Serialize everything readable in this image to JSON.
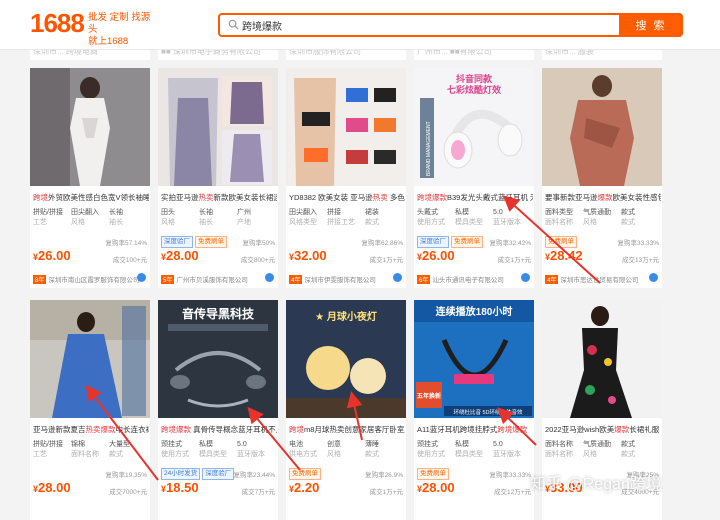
{
  "header": {
    "logo": "1688",
    "slogan_line1": "批发 定制 找源头",
    "slogan_line2": "就上1688",
    "search_value": "跨境爆款",
    "search_button": "搜 索"
  },
  "top_strip": [
    "深圳市... 跨境电商",
    "■■ 深圳市电子商务有限公司",
    "深圳市服饰有限公司",
    "广州市... ■■有限公司",
    "深圳市... 服装"
  ],
  "products": [
    {
      "title_pre": "",
      "title_hl": "跨境",
      "title_post": "外贸欧美性感白色宽V领长袖睡裙",
      "attrs": [
        [
          "拼贴/拼接",
          "工艺"
        ],
        [
          "田尖翻入",
          "风格"
        ],
        [
          "长袖",
          "袖长"
        ]
      ],
      "tags": [],
      "repurchase": "复购率57.14%",
      "price": "26.00",
      "sold": "成交100+元",
      "year": "8年",
      "shop": "深圳市南山区霞罗服饰有限公司"
    },
    {
      "title_pre": "实拍亚马逊",
      "title_hl": "热卖",
      "title_post": "新款欧美女装长裙连衣裙",
      "attrs": [
        [
          "田头",
          "风格"
        ],
        [
          "长袖",
          "袖长"
        ],
        [
          "广州",
          "产地"
        ]
      ],
      "tags": [
        [
          "深度验厂",
          "b"
        ],
        [
          "免费刷单",
          "o"
        ]
      ],
      "repurchase": "复购率50%",
      "price": "28.00",
      "sold": "成交800+元",
      "year": "5年",
      "shop": "广州市贝溪服饰有限公司"
    },
    {
      "title_pre": "YD8382 欧美女装 亚马逊",
      "title_hl": "热卖",
      "title_post": " 多色套装",
      "attrs": [
        [
          "田尖翻入",
          "风格类型"
        ],
        [
          "拼接",
          "拼接工艺"
        ],
        [
          "裙装",
          "款式"
        ]
      ],
      "tags": [],
      "repurchase": "复购率62.86%",
      "price": "32.00",
      "sold": "成交1万+元",
      "year": "4年",
      "shop": "深圳市伊雯服饰有限公司"
    },
    {
      "title_pre": "",
      "title_hl": "跨境爆款",
      "title_post": "B39发光头戴式蓝牙耳机 无",
      "attrs": [
        [
          "头戴式",
          "使用方式"
        ],
        [
          "私模",
          "模具类型"
        ],
        [
          "5.0",
          "蓝牙版本"
        ]
      ],
      "tags": [
        [
          "深度验厂",
          "b"
        ],
        [
          "免费刷单",
          "o"
        ]
      ],
      "repurchase": "复购率32.42%",
      "price": "26.00",
      "sold": "成交1万+元",
      "year": "6年",
      "shop": "汕头市通讯电子有限公司"
    },
    {
      "title_pre": "要事新款亚马逊",
      "title_hl": "爆款",
      "title_post": "欧美女装性感包",
      "attrs": [
        [
          "面料类型",
          "面料名称"
        ],
        [
          "气质通勤",
          "风格"
        ],
        [
          "款式",
          "款式"
        ]
      ],
      "tags": [
        [
          "免费刷单",
          "o"
        ]
      ],
      "repurchase": "复购率33.33%",
      "price": "28.42",
      "sold": "成交13万+元",
      "year": "4年",
      "shop": "深圳市思达世贸易有限公司"
    },
    {
      "title_pre": "亚马逊新款夏吉",
      "title_hl": "热卖爆款",
      "title_post": "中长连衣裙",
      "attrs": [
        [
          "拼贴/拼接",
          "工艺"
        ],
        [
          "锦棉",
          "面料名称"
        ],
        [
          "大量型",
          "款式"
        ]
      ],
      "tags": [],
      "repurchase": "复购率19.35%",
      "price": "28.00",
      "sold": "成交7000+元",
      "year": "",
      "shop": ""
    },
    {
      "title_pre": "",
      "title_hl": "跨境爆款",
      "title_post": " 真骨传导概念蓝牙耳机不入",
      "attrs": [
        [
          "颈挂式",
          "使用方式"
        ],
        [
          "私模",
          "模具类型"
        ],
        [
          "5.0",
          "蓝牙版本"
        ]
      ],
      "tags": [
        [
          "24小时发货",
          "b"
        ],
        [
          "深度验厂",
          "b"
        ]
      ],
      "repurchase": "复购率23.44%",
      "price": "18.50",
      "sold": "成交7万+元",
      "year": "",
      "shop": ""
    },
    {
      "title_pre": "",
      "title_hl": "跨境",
      "title_post": "m8月球热卖创意家居客厅卧室床头",
      "attrs": [
        [
          "电池",
          "供电方式"
        ],
        [
          "创意",
          "风格"
        ],
        [
          "薄睡",
          "款式"
        ]
      ],
      "tags": [
        [
          "免费刷单",
          "o"
        ]
      ],
      "repurchase": "复购率26.9%",
      "price": "2.20",
      "sold": "成交1万+元",
      "year": "",
      "shop": ""
    },
    {
      "title_pre": "A11蓝牙耳机跨境挂脖式",
      "title_hl": "跨境爆款",
      "title_post": "",
      "attrs": [
        [
          "颈挂式",
          "使用方式"
        ],
        [
          "私模",
          "模具类型"
        ],
        [
          "5.0",
          "蓝牙版本"
        ]
      ],
      "tags": [
        [
          "免费刷单",
          "o"
        ]
      ],
      "repurchase": "复购率33.33%",
      "price": "28.00",
      "sold": "成交12万+元",
      "year": "",
      "shop": ""
    },
    {
      "title_pre": "2022亚马逊wish欧美",
      "title_hl": "爆款",
      "title_post": "长裙礼服",
      "attrs": [
        [
          "面料名称",
          "面料名称"
        ],
        [
          "气质通勤",
          "风格"
        ],
        [
          "款式",
          "款式"
        ]
      ],
      "tags": [],
      "repurchase": "复购率25%",
      "price": "33.00",
      "sold": "成交4000+元",
      "year": "",
      "shop": ""
    }
  ],
  "banners": {
    "p2_title": "音传导黑科技",
    "p3_title": "★ 月球小夜灯",
    "p4_title_top": "抖音同款",
    "p4_title_bottom": "七彩炫酷灯效",
    "p4_vert": "BRAND MANAGEMENT",
    "p9_title": "连续播放180小时",
    "p9_badge": "五年换新",
    "p9_foot": "环绕杜比音 5D环绕立体音效"
  },
  "watermark": "知乎 @Regan跨境",
  "colors": {
    "accent": "#ff5c00",
    "price": "#ff5000",
    "title_highlight": "#e4393c",
    "blue_tag": "#3a7bd5"
  }
}
